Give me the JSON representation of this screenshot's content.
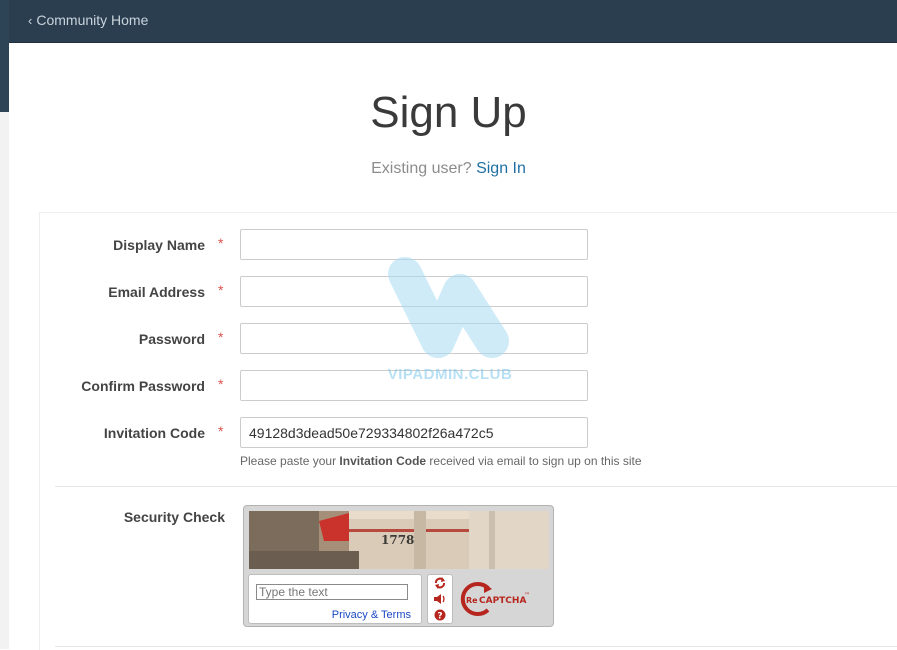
{
  "nav": {
    "back_label": "Community Home"
  },
  "header": {
    "title": "Sign Up",
    "existing_prompt": "Existing user?",
    "signin_label": "Sign In"
  },
  "form": {
    "fields": [
      {
        "label": "Display Name",
        "required": "*",
        "value": ""
      },
      {
        "label": "Email Address",
        "required": "*",
        "value": ""
      },
      {
        "label": "Password",
        "required": "*",
        "value": ""
      },
      {
        "label": "Confirm Password",
        "required": "*",
        "value": ""
      },
      {
        "label": "Invitation Code",
        "required": "*",
        "value": "49128d3dead50e729334802f26a472c5"
      }
    ],
    "hint_before": "Please paste your ",
    "hint_bold": "Invitation Code",
    "hint_after": " received via email to sign up on this site",
    "security_label": "Security Check"
  },
  "captcha": {
    "image_text": "1778",
    "placeholder": "Type the text",
    "privacy_terms": "Privacy & Terms",
    "logo_re": "Re",
    "logo_text": "CAPTCHA",
    "logo_tm": "™"
  },
  "watermark": {
    "text": "VIPADMIN.CLUB"
  },
  "colors": {
    "topbar": "#2b3e50",
    "link": "#1f6fa3",
    "required": "#d9534f",
    "captcha_red": "#b6261e"
  }
}
